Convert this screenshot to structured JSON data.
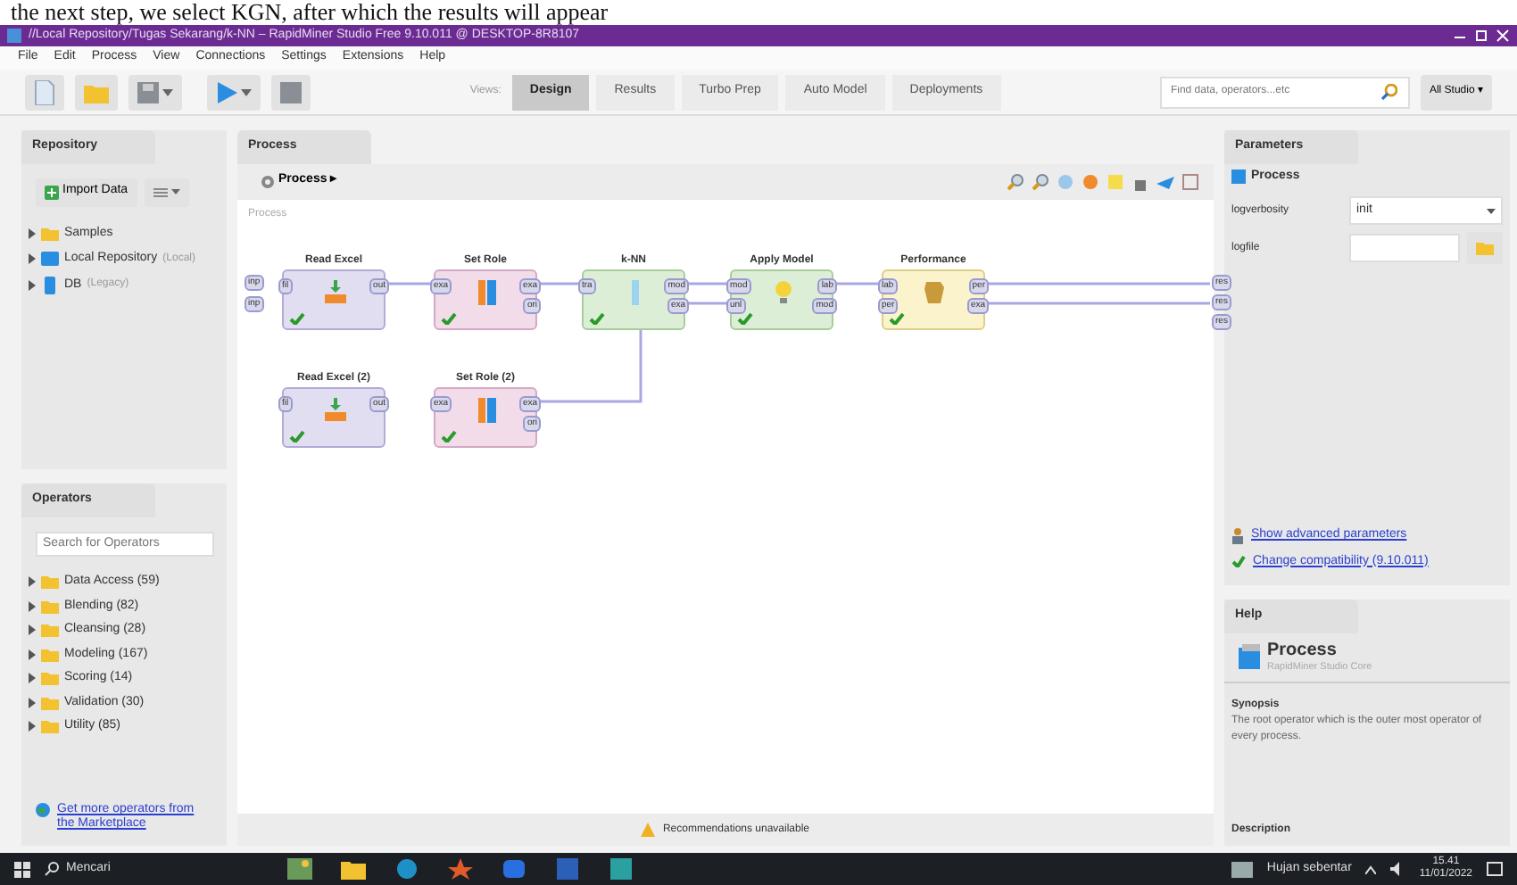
{
  "caption": "the next step, we select KGN, after which the results will appear",
  "window": {
    "title": "//Local Repository/Tugas Sekarang/k-NN – RapidMiner Studio Free 9.10.011 @ DESKTOP-8R8107"
  },
  "menu": [
    "File",
    "Edit",
    "Process",
    "View",
    "Connections",
    "Settings",
    "Extensions",
    "Help"
  ],
  "toolbar": {
    "views_label": "Views:",
    "views": [
      {
        "label": "Design",
        "selected": true
      },
      {
        "label": "Results",
        "selected": false
      },
      {
        "label": "Turbo Prep",
        "selected": false
      },
      {
        "label": "Auto Model",
        "selected": false
      },
      {
        "label": "Deployments",
        "selected": false
      }
    ],
    "search": {
      "placeholder": "Find data, operators...etc"
    },
    "studio_menu": "All Studio ▾"
  },
  "repository": {
    "title": "Repository",
    "import_button": "Import Data",
    "items": [
      {
        "kind": "folder",
        "label": "Samples"
      },
      {
        "kind": "repo",
        "label": "Local Repository",
        "hint": "(Local)"
      },
      {
        "kind": "db",
        "label": "DB",
        "hint": "(Legacy)"
      }
    ]
  },
  "operators_panel": {
    "title": "Operators",
    "search": {
      "placeholder": "Search for Operators"
    },
    "groups": [
      "Data Access (59)",
      "Blending (82)",
      "Cleansing (28)",
      "Modeling (167)",
      "Scoring (14)",
      "Validation (30)",
      "Utility (85)"
    ],
    "link": "Get more operators from the Marketplace"
  },
  "process": {
    "tab": "Process",
    "menu_button": "Process ▸",
    "breadcrumb": "Process",
    "input_ports": [
      "inp",
      "inp"
    ],
    "result_ports": [
      "res",
      "res",
      "res"
    ],
    "operators": [
      {
        "kind": "read",
        "title": "Read Excel",
        "in": [
          "fil"
        ],
        "out": [
          "out"
        ],
        "ok": true
      },
      {
        "kind": "role",
        "title": "Set Role",
        "in": [
          "exa"
        ],
        "out": [
          "exa",
          "ori"
        ],
        "ok": true
      },
      {
        "kind": "learner",
        "title": "k-NN",
        "in": [
          "tra"
        ],
        "out": [
          "mod",
          "exa"
        ],
        "ok": true
      },
      {
        "kind": "apply",
        "title": "Apply Model",
        "in": [
          "mod",
          "unl"
        ],
        "out": [
          "lab",
          "mod"
        ],
        "ok": true
      },
      {
        "kind": "performance",
        "title": "Performance",
        "in": [
          "lab",
          "per"
        ],
        "out": [
          "per",
          "exa"
        ],
        "ok": true
      },
      {
        "kind": "read",
        "title": "Read Excel (2)",
        "in": [
          "fil"
        ],
        "out": [
          "out"
        ],
        "ok": true
      },
      {
        "kind": "role",
        "title": "Set Role (2)",
        "in": [
          "exa"
        ],
        "out": [
          "exa",
          "ori"
        ],
        "ok": true
      }
    ],
    "status": "Recommendations unavailable"
  },
  "parameters": {
    "title": "Parameters",
    "context": "Process",
    "fields": [
      {
        "kind": "select",
        "label": "logverbosity",
        "value": "init"
      },
      {
        "kind": "file",
        "label": "logfile"
      }
    ],
    "links": [
      {
        "kind": "advanced",
        "label": "Show advanced parameters"
      },
      {
        "kind": "compat",
        "label": "Change compatibility (9.10.011)"
      }
    ]
  },
  "help": {
    "title": "Help",
    "heading": "Process",
    "source": "RapidMiner Studio Core",
    "synopsis_title": "Synopsis",
    "synopsis": "The root operator which is the outer most operator of every process.",
    "description_title": "Description"
  },
  "taskbar": {
    "search": "Mencari",
    "weather": "Hujan sebentar",
    "time": "15.41",
    "date": "11/01/2022"
  }
}
